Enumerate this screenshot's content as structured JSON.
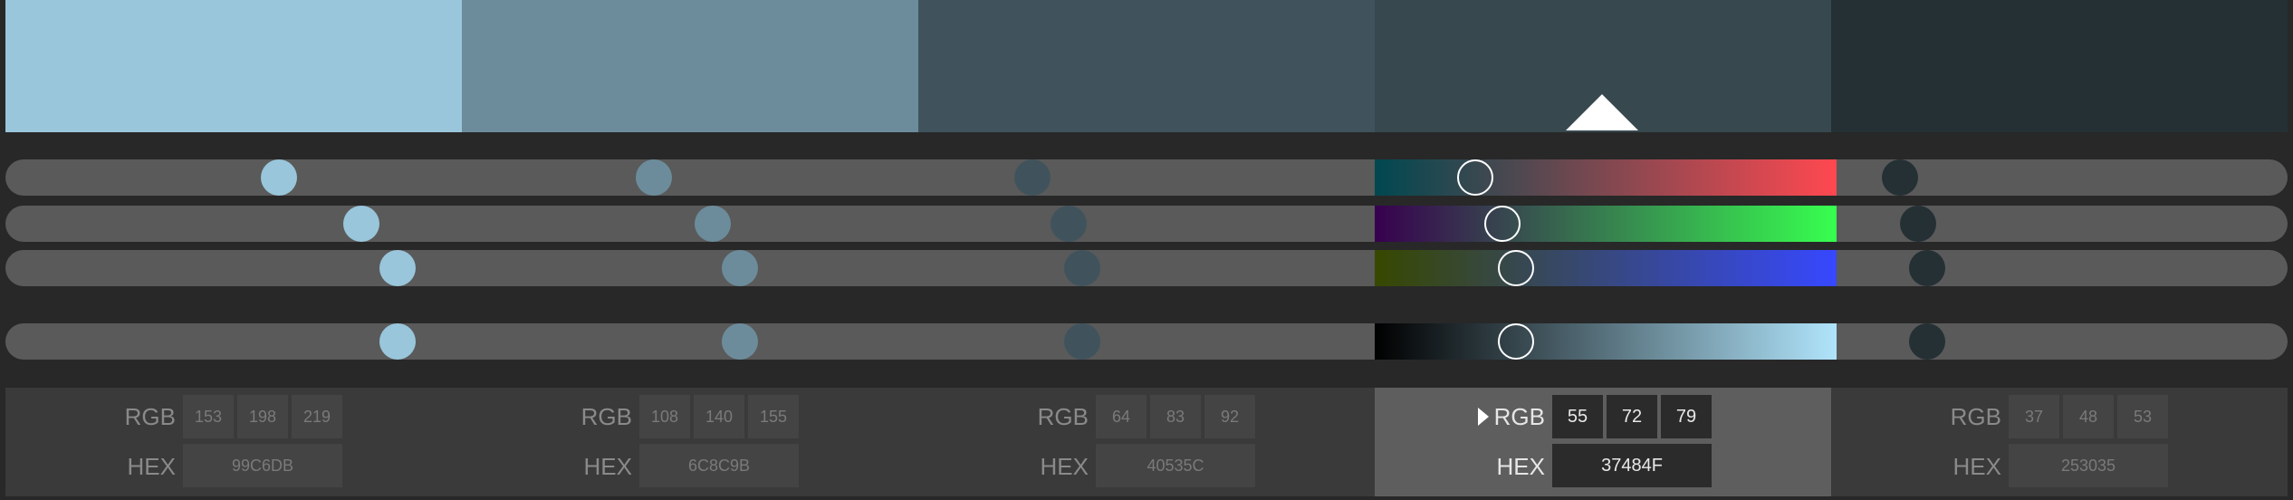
{
  "palette": {
    "selected_index": 3,
    "colors": [
      {
        "hex_color": "#99C6DB",
        "knob_color": "#99C6DB",
        "rgb_label": "RGB",
        "hex_label": "HEX",
        "r": "153",
        "g": "198",
        "b": "219",
        "hex": "99C6DB"
      },
      {
        "hex_color": "#6C8C9B",
        "knob_color": "#6C8C9B",
        "rgb_label": "RGB",
        "hex_label": "HEX",
        "r": "108",
        "g": "140",
        "b": "155",
        "hex": "6C8C9B"
      },
      {
        "hex_color": "#40535C",
        "knob_color": "#40535C",
        "rgb_label": "RGB",
        "hex_label": "HEX",
        "r": "64",
        "g": "83",
        "b": "92",
        "hex": "40535C"
      },
      {
        "hex_color": "#37484F",
        "knob_color": "#37484F",
        "rgb_label": "RGB",
        "hex_label": "HEX",
        "r": "55",
        "g": "72",
        "b": "79",
        "hex": "37484F"
      },
      {
        "hex_color": "#253035",
        "knob_color": "#253035",
        "rgb_label": "RGB",
        "hex_label": "HEX",
        "r": "37",
        "g": "48",
        "b": "53",
        "hex": "253035"
      }
    ]
  },
  "sliders": {
    "channels": [
      "R",
      "G",
      "B",
      "L"
    ],
    "levels": [
      [
        0.6,
        0.78,
        0.86,
        0.86
      ],
      [
        0.42,
        0.55,
        0.61,
        0.61
      ],
      [
        0.25,
        0.33,
        0.36,
        0.36
      ],
      [
        0.22,
        0.28,
        0.31,
        0.31
      ],
      [
        0.15,
        0.19,
        0.21,
        0.21
      ]
    ],
    "gradients": [
      "linear-gradient(to right, #004850, #ff4850)",
      "linear-gradient(to right, #37004f, #37ff4f)",
      "linear-gradient(to right, #374800, #3748ff)",
      "linear-gradient(to right, #000000, #b0e4fb)"
    ]
  }
}
